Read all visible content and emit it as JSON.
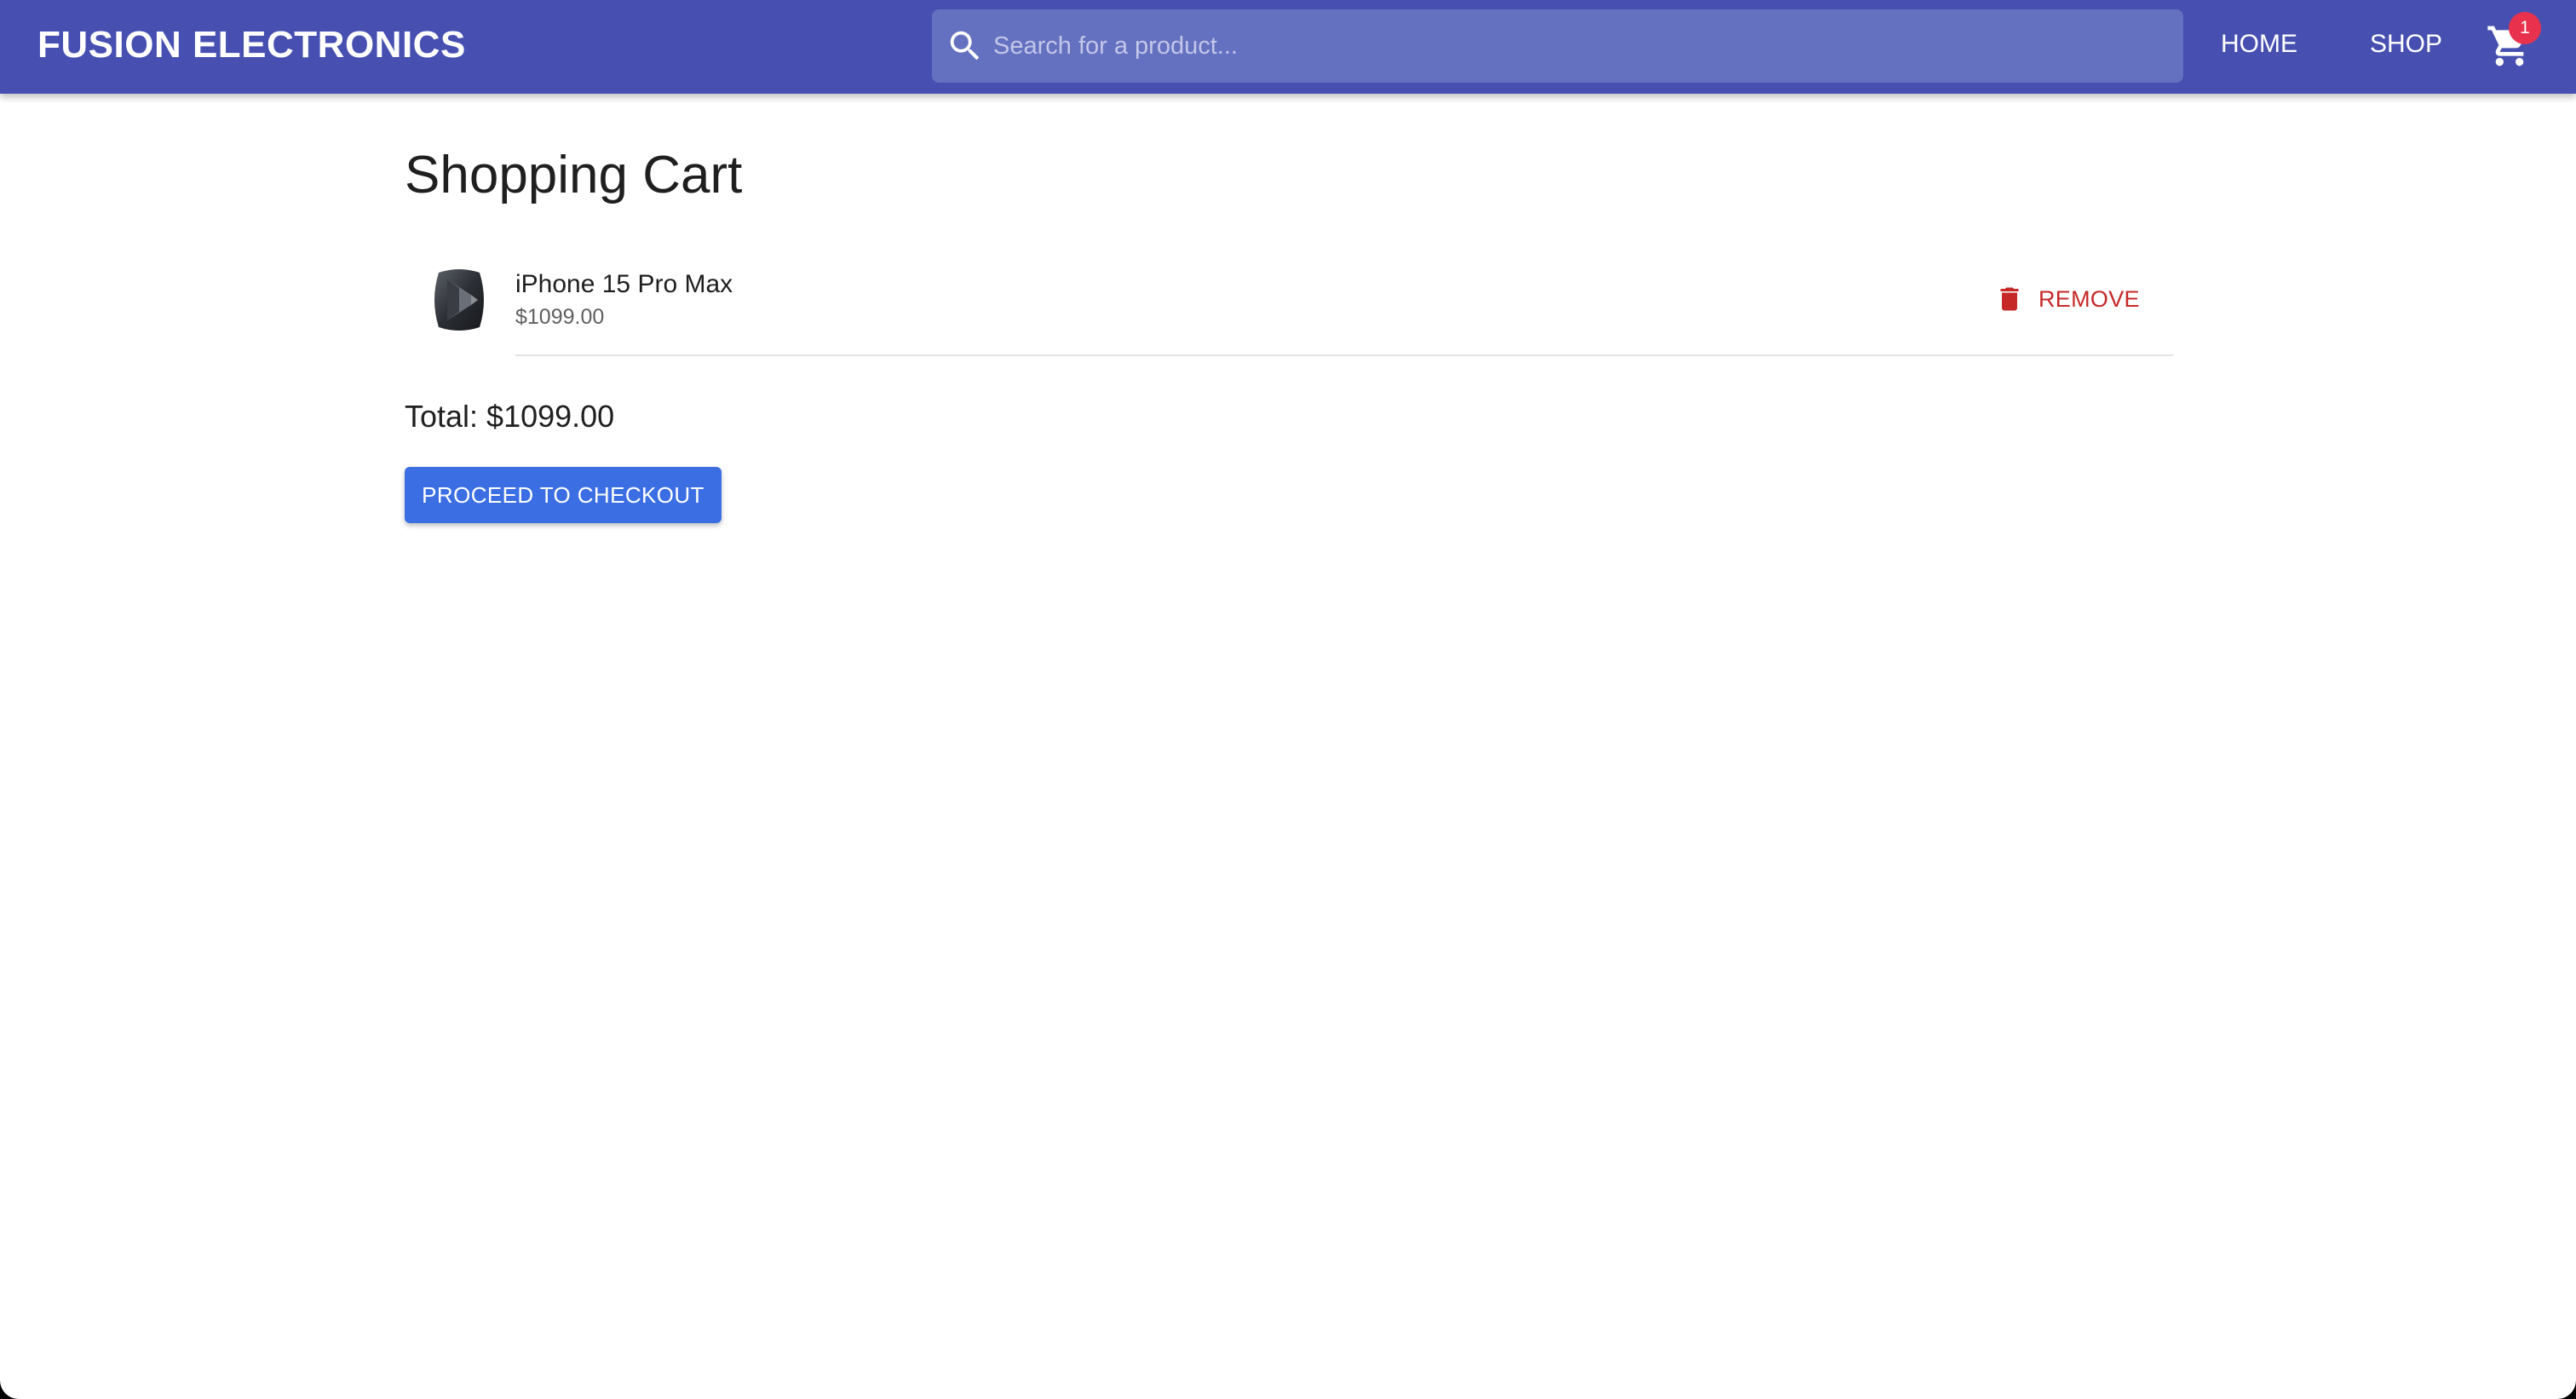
{
  "header": {
    "brand": "FUSION ELECTRONICS",
    "search": {
      "placeholder": "Search for a product...",
      "value": ""
    },
    "nav": {
      "home": "HOME",
      "shop": "SHOP"
    },
    "cart_count": "1",
    "colors": {
      "appbar": "#4750b1",
      "badge": "#e8324d"
    }
  },
  "page": {
    "title": "Shopping Cart",
    "items": [
      {
        "name": "iPhone 15 Pro Max",
        "price": "$1099.00",
        "remove_label": "REMOVE"
      }
    ],
    "total_label": "Total: $1099.00",
    "checkout_label": "PROCEED TO CHECKOUT",
    "colors": {
      "remove": "#c62828",
      "checkout": "#3b6ee3"
    }
  }
}
